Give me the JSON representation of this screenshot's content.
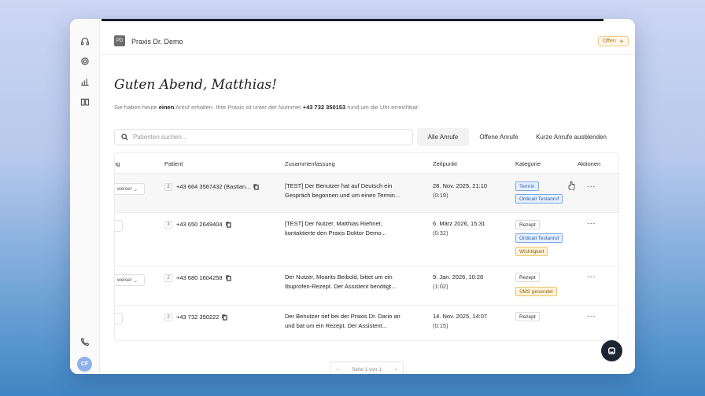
{
  "header": {
    "practice_name": "Praxis Dr. Demo",
    "practice_logo": "PD",
    "status_label": "Offen",
    "status_icon": "sun-icon"
  },
  "sidebar": {
    "icons": [
      "headset-icon",
      "gear-icon",
      "chart-icon",
      "book-icon",
      "phone-icon"
    ],
    "avatar_initials": "CF"
  },
  "greeting": "Guten Abend, Matthias!",
  "intro": {
    "part1": "Sie haben heute ",
    "count": "einen",
    "part2": " Anruf erhalten. Ihre Praxis ist unter der Nummer ",
    "number": "+43 732 350153",
    "part3": " rund um die Uhr erreichbar."
  },
  "search": {
    "placeholder": "Patienten suchen..."
  },
  "filters": [
    "Alle Anrufe",
    "Offene Anrufe",
    "Kurze Anrufe ausblenden"
  ],
  "columns": [
    "ng",
    "Patient",
    "Zusammenfassung",
    "Zeitpunkt",
    "Kategorie",
    "Aktionen"
  ],
  "rows": [
    {
      "stub": "weiser",
      "calls": "2",
      "patient": "+43 664 3567432 (Bastian...",
      "summary1": "[TEST] Der Benutzer hat auf Deutsch ein",
      "summary2": "Gespräch begonnen und um einen Termin...",
      "time": "28. Nov. 2025, 21:10",
      "duration": "(0:19)",
      "tags": [
        {
          "label": "Termin",
          "style": "blue"
        },
        {
          "label": "Ordicall Testanruf",
          "style": "blue"
        }
      ]
    },
    {
      "stub": "",
      "calls": "3",
      "patient": "+43 650 2649404",
      "summary1": "[TEST] Der Nutzer, Matthias Riehner,",
      "summary2": "kontaktierte den Praxis Doktor Demo...",
      "time": "6. März 2026, 15:31",
      "duration": "(0:32)",
      "tags": [
        {
          "label": "Rezept",
          "style": "plain"
        },
        {
          "label": "Ordicall Testanruf",
          "style": "blue"
        },
        {
          "label": "Wichtigkeit",
          "style": "yellow"
        }
      ]
    },
    {
      "stub": "weiser",
      "calls": "2",
      "patient": "+43 680 1604258",
      "summary1": "Der Nutzer, Moarits Beibold, bittet um ein",
      "summary2": "Ibuprofen-Rezept. Der Assistent benötigt...",
      "time": "9. Jan. 2026, 10:28",
      "duration": "(1:02)",
      "tags": [
        {
          "label": "Rezept",
          "style": "plain"
        },
        {
          "label": "SMS gesendet",
          "style": "yellow"
        }
      ]
    },
    {
      "stub": "",
      "calls": "2",
      "patient": "+43 732 350222",
      "summary1": "Der Benutzer rief bei der Praxis Dr. Dario an",
      "summary2": "und bat um ein Rezept. Der Assistent...",
      "time": "14. Nov. 2025, 14:07",
      "duration": "(0:15)",
      "tags": [
        {
          "label": "Rezept",
          "style": "plain"
        }
      ]
    }
  ],
  "actions_label": "...",
  "pagination": {
    "label": "Seite 1 von 1",
    "prev": "‹",
    "next": "›"
  }
}
